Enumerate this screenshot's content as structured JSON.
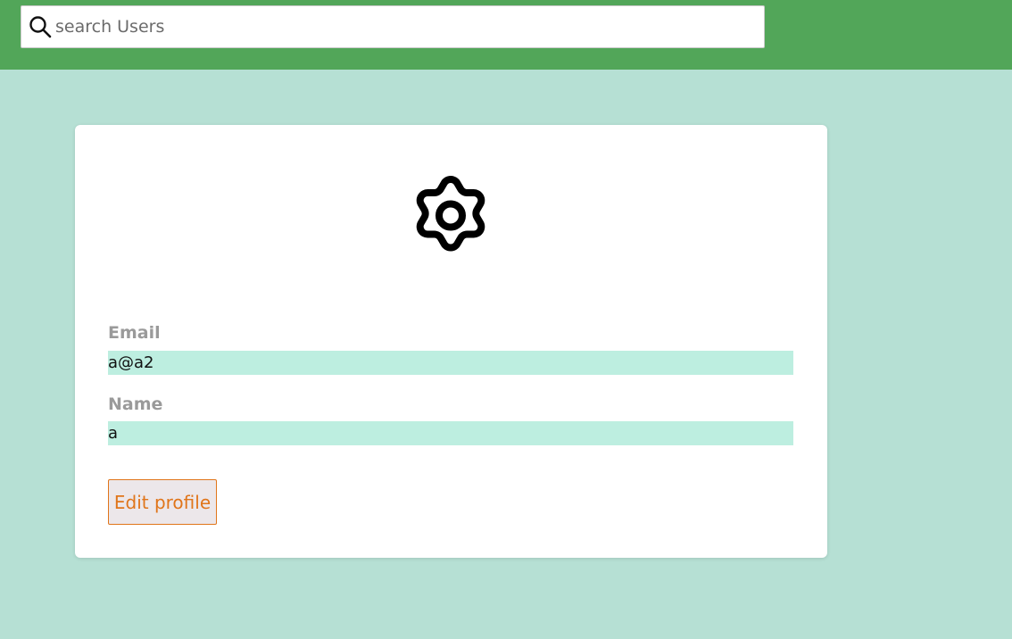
{
  "header": {
    "search": {
      "placeholder": "search Users",
      "value": "",
      "icon": "search-icon"
    }
  },
  "profile": {
    "icon": "gear-icon",
    "email": {
      "label": "Email",
      "value": "a@a2"
    },
    "name": {
      "label": "Name",
      "value": "a"
    },
    "edit_button_label": "Edit profile"
  },
  "colors": {
    "topbar": "#52a659",
    "page_background": "#b6e0d4",
    "field_background": "#bdeee0",
    "accent_orange": "#e0751a"
  }
}
